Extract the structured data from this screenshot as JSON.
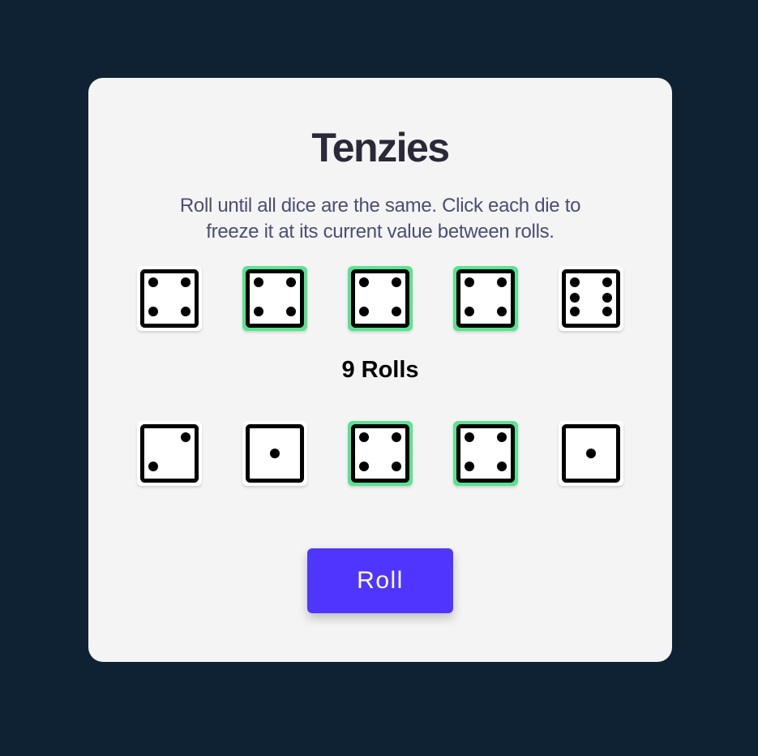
{
  "game": {
    "title": "Tenzies",
    "instructions": "Roll until all dice are the same. Click each die to freeze it at its current value between rolls.",
    "rolls_count_label": "9 Rolls",
    "roll_button_label": "Roll"
  },
  "colors": {
    "page_background": "#0e2233",
    "card_background": "#f4f4f4",
    "held_die_border": "#59e391",
    "roll_button": "#5035ff"
  },
  "dice": [
    {
      "value": 4,
      "held": false
    },
    {
      "value": 4,
      "held": true
    },
    {
      "value": 4,
      "held": true
    },
    {
      "value": 4,
      "held": true
    },
    {
      "value": 6,
      "held": false
    },
    {
      "value": 2,
      "held": false
    },
    {
      "value": 1,
      "held": false
    },
    {
      "value": 4,
      "held": true
    },
    {
      "value": 4,
      "held": true
    },
    {
      "value": 1,
      "held": false
    }
  ]
}
